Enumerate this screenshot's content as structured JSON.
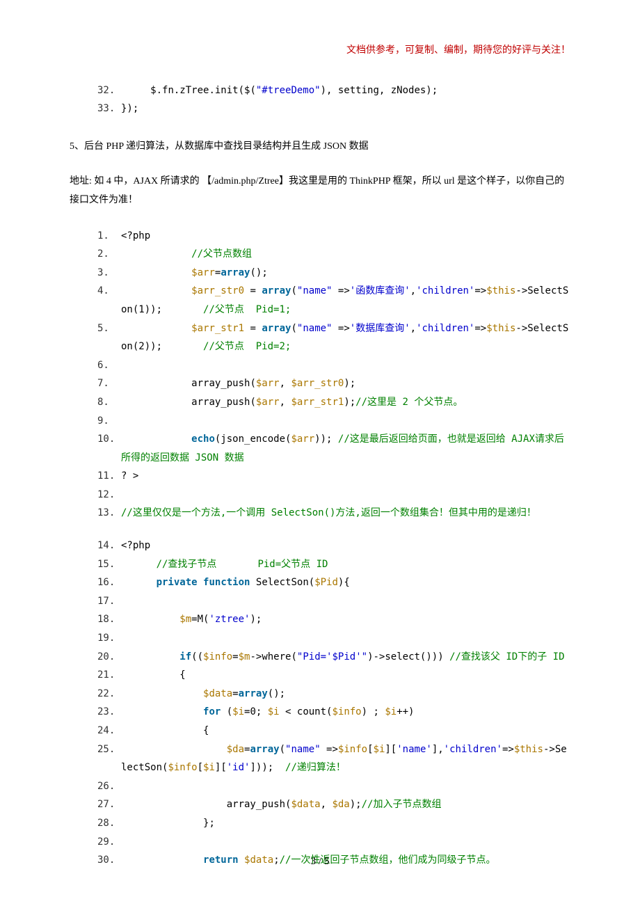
{
  "header": {
    "note": "文档供参考，可复制、编制，期待您的好评与关注！"
  },
  "block1": {
    "l32_no": "32.",
    "l32_p1": "     $.fn.zTree.init($(",
    "l32_str": "\"#treeDemo\"",
    "l32_p2": "), setting, zNodes);",
    "l33_no": "33.",
    "l33_txt": "});"
  },
  "sec5_title": "5、后台 PHP 递归算法，从数据库中查找目录结构并且生成 JSON 数据",
  "sec5_para": "地址: 如 4 中，AJAX 所请求的 【/admin.php/Ztree】我这里是用的 ThinkPHP 框架，所以 url 是这个样子，以你自己的接口文件为准！",
  "block2": {
    "l1_no": "1.",
    "l1_txt": "<?php",
    "l2_no": "2.",
    "l2_cm": "//父节点数组",
    "l3_no": "3.",
    "l3_var1": "$arr",
    "l3_eq": "=",
    "l3_kw": "array",
    "l3_txt": "();",
    "l4_no": "4.",
    "l4_var1": "$arr_str0",
    "l4_eq": " = ",
    "l4_kw": "array",
    "l4_p1": "(",
    "l4_s1": "\"name\"",
    "l4_p2": " =>",
    "l4_s2": "'函数库查询'",
    "l4_p3": ",",
    "l4_s3": "'children'",
    "l4_p4": "=>",
    "l4_var2": "$this",
    "l4_p5": "->SelectSon(1));",
    "l4_cm": "//父节点  Pid=1;",
    "l5_no": "5.",
    "l5_var1": "$arr_str1",
    "l5_eq": " = ",
    "l5_kw": "array",
    "l5_p1": "(",
    "l5_s1": "\"name\"",
    "l5_p2": " =>",
    "l5_s2": "'数据库查询'",
    "l5_p3": ",",
    "l5_s3": "'children'",
    "l5_p4": "=>",
    "l5_var2": "$this",
    "l5_p5": "->SelectSon(2));",
    "l5_cm": "//父节点  Pid=2;",
    "l6_no": "6.",
    "l7_no": "7.",
    "l7_txt1": "array_push(",
    "l7_var1": "$arr",
    "l7_txt2": ", ",
    "l7_var2": "$arr_str0",
    "l7_txt3": ");",
    "l8_no": "8.",
    "l8_txt1": "array_push(",
    "l8_var1": "$arr",
    "l8_txt2": ", ",
    "l8_var2": "$arr_str1",
    "l8_txt3": ");",
    "l8_cm": "//这里是 2 个父节点。",
    "l9_no": "9.",
    "l10_no": "10.",
    "l10_kw": "echo",
    "l10_txt1": "(json_encode(",
    "l10_var": "$arr",
    "l10_txt2": ")); ",
    "l10_cm1": "//这是最后返回给页面，也就是返回给 AJAX请求后所得的返回数据 JSON 数据",
    "l11_no": "11.",
    "l11_txt": "? >",
    "l12_no": "12.",
    "l13_no": "13.",
    "l13_cm": "//这里仅仅是一个方法,一个调用 SelectSon()方法,返回一个数组集合！但其中用的是递归！",
    "l14_no": "14.",
    "l14_txt": "<?php",
    "l15_no": "15.",
    "l15_cm1": "//查找子节点",
    "l15_cm2": "Pid=父节点 ID",
    "l16_no": "16.",
    "l16_kw1": "private",
    "l16_kw2": "function",
    "l16_txt1": " SelectSon(",
    "l16_var": "$Pid",
    "l16_txt2": "){",
    "l17_no": "17.",
    "l18_no": "18.",
    "l18_var": "$m",
    "l18_txt1": "=M(",
    "l18_s": "'ztree'",
    "l18_txt2": ");",
    "l19_no": "19.",
    "l20_no": "20.",
    "l20_kw": "if",
    "l20_txt1": "((",
    "l20_var1": "$info",
    "l20_eq": "=",
    "l20_var2": "$m",
    "l20_txt2": "->where(",
    "l20_s": "\"Pid='$Pid'\"",
    "l20_txt3": ")->select())) ",
    "l20_cm": "//查找该父 ID下的子 ID",
    "l21_no": "21.",
    "l21_txt": "{",
    "l22_no": "22.",
    "l22_var": "$data",
    "l22_eq": "=",
    "l22_kw": "array",
    "l22_txt": "();",
    "l23_no": "23.",
    "l23_kw": "for",
    "l23_txt1": " (",
    "l23_var1": "$i",
    "l23_txt2": "=0; ",
    "l23_var2": "$i",
    "l23_txt3": " < count(",
    "l23_var3": "$info",
    "l23_txt4": ") ; ",
    "l23_var4": "$i",
    "l23_txt5": "++)",
    "l24_no": "24.",
    "l24_txt": "{",
    "l25_no": "25.",
    "l25_var1": "$da",
    "l25_eq": "=",
    "l25_kw": "array",
    "l25_txt1": "(",
    "l25_s1": "\"name\"",
    "l25_txt2": " =>",
    "l25_var2": "$info",
    "l25_txt3": "[",
    "l25_var3": "$i",
    "l25_txt4": "][",
    "l25_s2": "'name'",
    "l25_txt5": "],",
    "l25_s3": "'children'",
    "l25_txt6": "=>",
    "l25_var4": "$this",
    "l25_txt7": "->SelectSon(",
    "l25_var5": "$info",
    "l25_txt8": "[",
    "l25_var6": "$i",
    "l25_txt9": "][",
    "l25_s4": "'id'",
    "l25_txt10": "]));  ",
    "l25_cm": "//递归算法！",
    "l26_no": "26.",
    "l27_no": "27.",
    "l27_txt1": "array_push(",
    "l27_var1": "$data",
    "l27_txt2": ", ",
    "l27_var2": "$da",
    "l27_txt3": ");",
    "l27_cm": "//加入子节点数组",
    "l28_no": "28.",
    "l28_txt": "};",
    "l29_no": "29.",
    "l30_no": "30.",
    "l30_kw": "return",
    "l30_sp": " ",
    "l30_var": "$data",
    "l30_txt": ";",
    "l30_cm": "//一次性返回子节点数组，他们成为同级子节点。"
  },
  "footer": {
    "page": "3 / 5"
  }
}
